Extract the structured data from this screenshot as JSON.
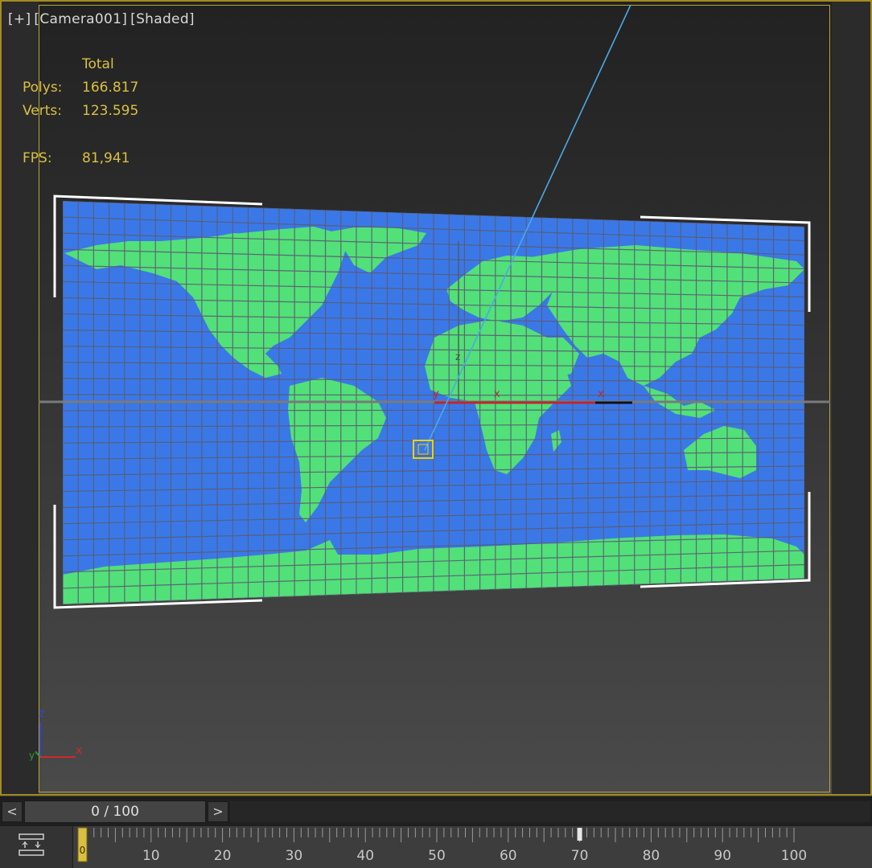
{
  "viewport": {
    "label_plus": "[+]",
    "label_camera": "[Camera001]",
    "label_mode": "[Shaded]"
  },
  "stats": {
    "header": "Total",
    "polys_label": "Polys:",
    "polys_value": "166.817",
    "verts_label": "Verts:",
    "verts_value": "123.595",
    "fps_label": "FPS:",
    "fps_value": "81,941"
  },
  "gizmo": {
    "axis_x": "x",
    "axis_y": "y",
    "axis_z": "z",
    "axis_x2": "x"
  },
  "corner_axes": {
    "x": "x",
    "y": "y",
    "z": "z"
  },
  "time_slider": {
    "prev": "<",
    "next": ">",
    "position": "0 / 100"
  },
  "track_bar": {
    "ticks": [
      "10",
      "20",
      "30",
      "40",
      "50",
      "60",
      "70",
      "80",
      "90",
      "100"
    ],
    "current_frame": "0",
    "frame_start": 0,
    "frame_end": 100,
    "key_frame": 70
  },
  "colors": {
    "ocean": "#3b78e7",
    "land": "#52e079",
    "frame_border": "#a38b21",
    "stats_text": "#d9c042"
  }
}
